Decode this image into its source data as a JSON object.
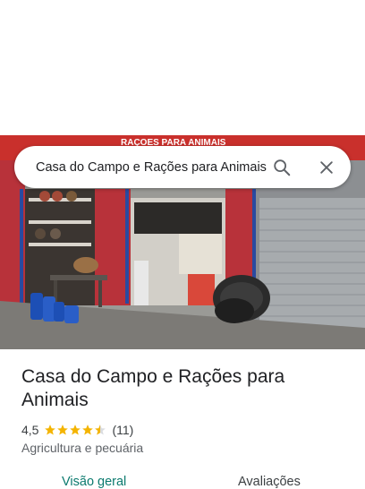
{
  "search": {
    "query": "Casa do Campo e Rações para Animais"
  },
  "icons": {
    "search": "search-icon",
    "close": "close-icon",
    "star": "star-icon"
  },
  "place": {
    "name": "Casa do Campo e Rações para Animais",
    "rating": "4,5",
    "stars": 4.5,
    "reviews": "(11)",
    "category": "Agricultura e pecuária"
  },
  "photo": {
    "sign_text": "RAÇOES PARA ANIMAIS"
  },
  "tabs": [
    {
      "label": "Visão geral",
      "active": true
    },
    {
      "label": "Avaliações",
      "active": false
    }
  ],
  "colors": {
    "accent": "#0b7a6e",
    "star": "#f4b400",
    "text": "#202124"
  }
}
